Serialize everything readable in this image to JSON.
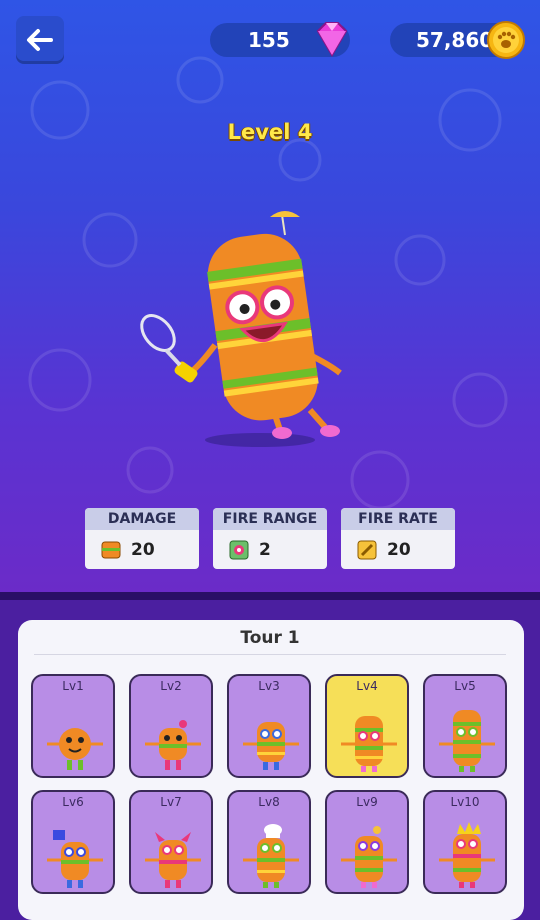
{
  "header": {
    "gems": "155",
    "coins": "57,860"
  },
  "level_title": "Level 4",
  "stats": [
    {
      "label": "DAMAGE",
      "value": "20",
      "icon": "burger-icon"
    },
    {
      "label": "FIRE RANGE",
      "value": "2",
      "icon": "range-icon"
    },
    {
      "label": "FIRE RATE",
      "value": "20",
      "icon": "rate-icon"
    }
  ],
  "tour": {
    "title": "Tour 1",
    "levels": [
      "Lv1",
      "Lv2",
      "Lv3",
      "Lv4",
      "Lv5",
      "Lv6",
      "Lv7",
      "Lv8",
      "Lv9",
      "Lv10"
    ],
    "selected": "Lv4"
  },
  "colors": {
    "gold": "#ffe84a",
    "tile": "#b88de6",
    "tile_selected": "#f6df58"
  }
}
